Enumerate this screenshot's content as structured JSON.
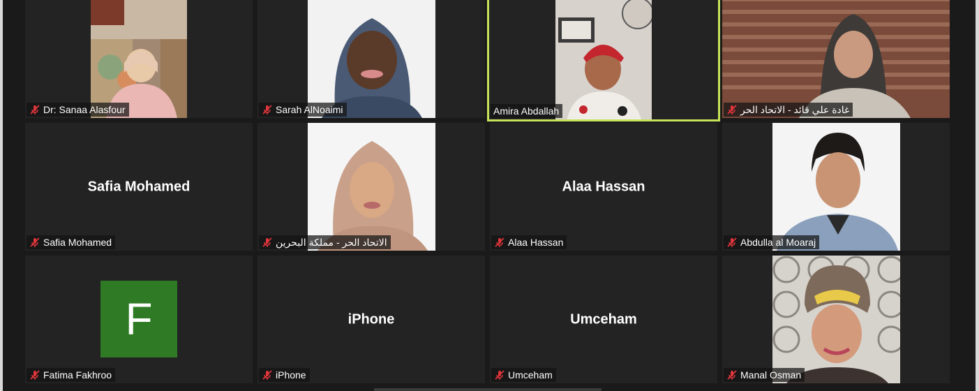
{
  "participants": [
    {
      "name": "Dr: Sanaa Alasfour",
      "muted": true,
      "video": true
    },
    {
      "name": "Sarah AlNoaimi",
      "muted": true,
      "video": true
    },
    {
      "name": "Amira Abdallah",
      "muted": false,
      "video": true,
      "speaking": true
    },
    {
      "name": "غادة علي قائد - الاتحاد الحر",
      "muted": true,
      "video": true
    },
    {
      "name": "Safia Mohamed",
      "muted": true,
      "video": false,
      "tile_text": "Safia Mohamed"
    },
    {
      "name": "الاتحاد الحر - مملكة البحرين",
      "muted": true,
      "video": true
    },
    {
      "name": "Alaa Hassan",
      "muted": true,
      "video": false,
      "tile_text": "Alaa Hassan"
    },
    {
      "name": "Abdulla al Moaraj",
      "muted": true,
      "video": true
    },
    {
      "name": "Fatima Fakhroo",
      "muted": true,
      "video": false,
      "avatar_letter": "F",
      "avatar_color": "#2f7a24"
    },
    {
      "name": "iPhone",
      "muted": true,
      "video": false,
      "tile_text": "iPhone"
    },
    {
      "name": "Umceham",
      "muted": true,
      "video": false,
      "tile_text": "Umceham"
    },
    {
      "name": "Manal Osman",
      "muted": true,
      "video": true
    }
  ],
  "colors": {
    "background": "#1a1a1a",
    "tile": "#232323",
    "active_speaker_border": "#c7e35a",
    "muted_icon": "#e0353b"
  }
}
